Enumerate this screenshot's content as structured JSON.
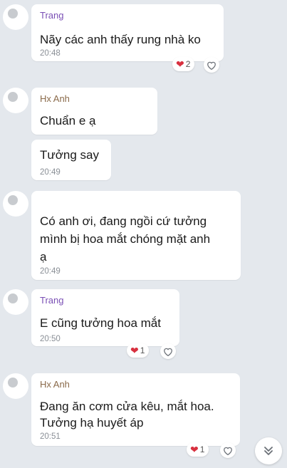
{
  "colors": {
    "sender_purple": "#7a4fb5",
    "sender_brown": "#8a6a4a",
    "heart": "#d8303f"
  },
  "messages": [
    {
      "sender": "Trang",
      "text": "Nãy các anh thấy rung nhà ko",
      "time": "20:48",
      "reaction_count": "2"
    },
    {
      "sender": "Hx Anh",
      "text": "Chuẩn e ạ"
    },
    {
      "text": "Tưởng say",
      "time": "20:49"
    },
    {
      "text_lines": [
        "Có anh ơi, đang ngồi cứ tưởng",
        "mình bị hoa mắt chóng mặt anh",
        "ạ"
      ],
      "time": "20:49"
    },
    {
      "sender": "Trang",
      "text": "E cũng tưởng hoa mắt",
      "time": "20:50",
      "reaction_count": "1"
    },
    {
      "sender": "Hx Anh",
      "text_lines": [
        "Đang ăn cơm cửa kêu, mắt hoa.",
        "Tưởng hạ huyết áp"
      ],
      "time": "20:51",
      "reaction_count": "1"
    }
  ],
  "icons": {
    "reaction": "heart-icon",
    "like": "outline-heart-icon",
    "scroll": "double-chevron-down-icon"
  }
}
